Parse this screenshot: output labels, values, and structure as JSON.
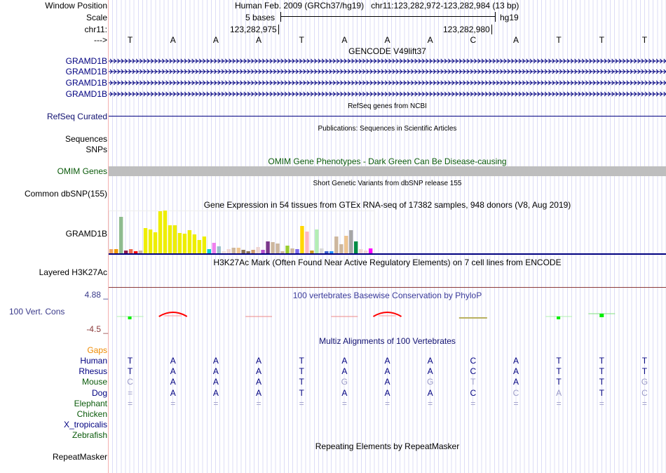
{
  "header": {
    "window_position_label": "Window Position",
    "scale_label": "Scale",
    "chrom_label": "chr11:",
    "strand_label": "--->",
    "assembly": "Human Feb. 2009 (GRCh37/hg19)",
    "position": "chr11:123,282,972-123,282,984 (13 bp)",
    "scale_text": "5 bases",
    "db": "hg19",
    "tick_left": "123,282,975",
    "tick_right": "123,282,980",
    "sequence": "TAAATAAACATTT"
  },
  "gencode": {
    "title": "GENCODE V49lift37",
    "genes": [
      "GRAMD1B",
      "GRAMD1B",
      "GRAMD1B",
      "GRAMD1B"
    ],
    "color": "#000080"
  },
  "refseq": {
    "title": "RefSeq genes from NCBI",
    "label": "RefSeq Curated"
  },
  "publications": {
    "title": "Publications: Sequences in Scientific Articles",
    "labels": [
      "Sequences",
      "SNPs"
    ]
  },
  "omim": {
    "title": "OMIM Gene Phenotypes - Dark Green Can Be Disease-causing",
    "label": "OMIM Genes",
    "bar_color": "#bebebe"
  },
  "dbsnp": {
    "title": "Short Genetic Variants from dbSNP release 155",
    "label": "Common dbSNP(155)"
  },
  "gtex": {
    "title": "Gene Expression in 54 tissues from GTEx RNA-seq of 17382 samples, 948 donors (V8, Aug 2019)",
    "label": "GRAMD1B",
    "values": [
      6,
      6,
      52,
      4,
      6,
      3,
      4,
      36,
      34,
      30,
      60,
      61,
      40,
      40,
      29,
      28,
      33,
      27,
      19,
      24,
      6,
      15,
      10,
      3,
      6,
      8,
      8,
      5,
      3,
      5,
      9,
      5,
      17,
      16,
      14,
      3,
      11,
      7,
      6,
      39,
      31,
      4,
      34,
      7,
      3,
      3,
      24,
      13,
      25,
      33,
      17,
      6,
      4,
      7
    ],
    "colors": [
      "#f4a460",
      "#f09a00",
      "#8fbc8f",
      "#8b1a50",
      "#ee6a50",
      "#ff0000",
      "#cdb79e",
      "#eeee00",
      "#eeee00",
      "#eeee00",
      "#eeee00",
      "#eeee00",
      "#eeee00",
      "#eeee00",
      "#eeee00",
      "#eeee00",
      "#eeee00",
      "#eeee00",
      "#eeee00",
      "#eeee00",
      "#00ced1",
      "#ee82ee",
      "#9ac0cd",
      "#eedfd8",
      "#eed5d2",
      "#cdb79e",
      "#eec591",
      "#8b7355",
      "#8b7355",
      "#cd9b6e",
      "#eed5d2",
      "#b452cd",
      "#7a378b",
      "#cdb79e",
      "#cdb79e",
      "#cdb79e",
      "#9acd32",
      "#cdb79e",
      "#7b68ee",
      "#ffd700",
      "#ffb6c1",
      "#cd9b1d",
      "#b4eeb4",
      "#d9d9d9",
      "#3a5fcd",
      "#1e90ff",
      "#cdb79e",
      "#cdb79e",
      "#eec591",
      "#a6a6a6",
      "#008b45",
      "#eed5d2",
      "#eed5d2",
      "#ff00ff"
    ]
  },
  "h3k27ac": {
    "title": "H3K27Ac Mark (Often Found Near Active Regulatory Elements) on 7 cell lines from ENCODE",
    "label": "Layered H3K27Ac"
  },
  "phylop": {
    "title": "100 vertebrates Basewise Conservation by PhyloP",
    "label": "100 Vert. Cons",
    "max": "4.88 _",
    "min": "-4.5 _",
    "marks": [
      "green-low",
      "red-peak",
      "none",
      "red-flat",
      "none",
      "red-flat",
      "red-peak",
      "none",
      "olive-flat",
      "none",
      "green-low",
      "green-high",
      "none"
    ]
  },
  "multiz": {
    "title": "Multiz Alignments of 100 Vertebrates",
    "gaps_label": "Gaps",
    "species": [
      {
        "name": "Human",
        "seq": "TAAATAAACATTT",
        "color": "#000080"
      },
      {
        "name": "Rhesus",
        "seq": "TAAATAAACATTT",
        "color": "#000080"
      },
      {
        "name": "Mouse",
        "seq": "CAAATGAGTATTG",
        "color": "#0a5a0a"
      },
      {
        "name": "Dog",
        "seq": "=AAATAAACCATC",
        "color": "#000080"
      },
      {
        "name": "Elephant",
        "seq": "=============",
        "color": "#0a5a0a"
      },
      {
        "name": "Chicken",
        "seq": "",
        "color": "#0a5a0a"
      },
      {
        "name": "X_tropicalis",
        "seq": "",
        "color": "#000080"
      },
      {
        "name": "Zebrafish",
        "seq": "",
        "color": "#0a5a0a"
      }
    ]
  },
  "repeatmasker": {
    "title": "Repeating Elements by RepeatMasker",
    "label": "RepeatMasker"
  }
}
